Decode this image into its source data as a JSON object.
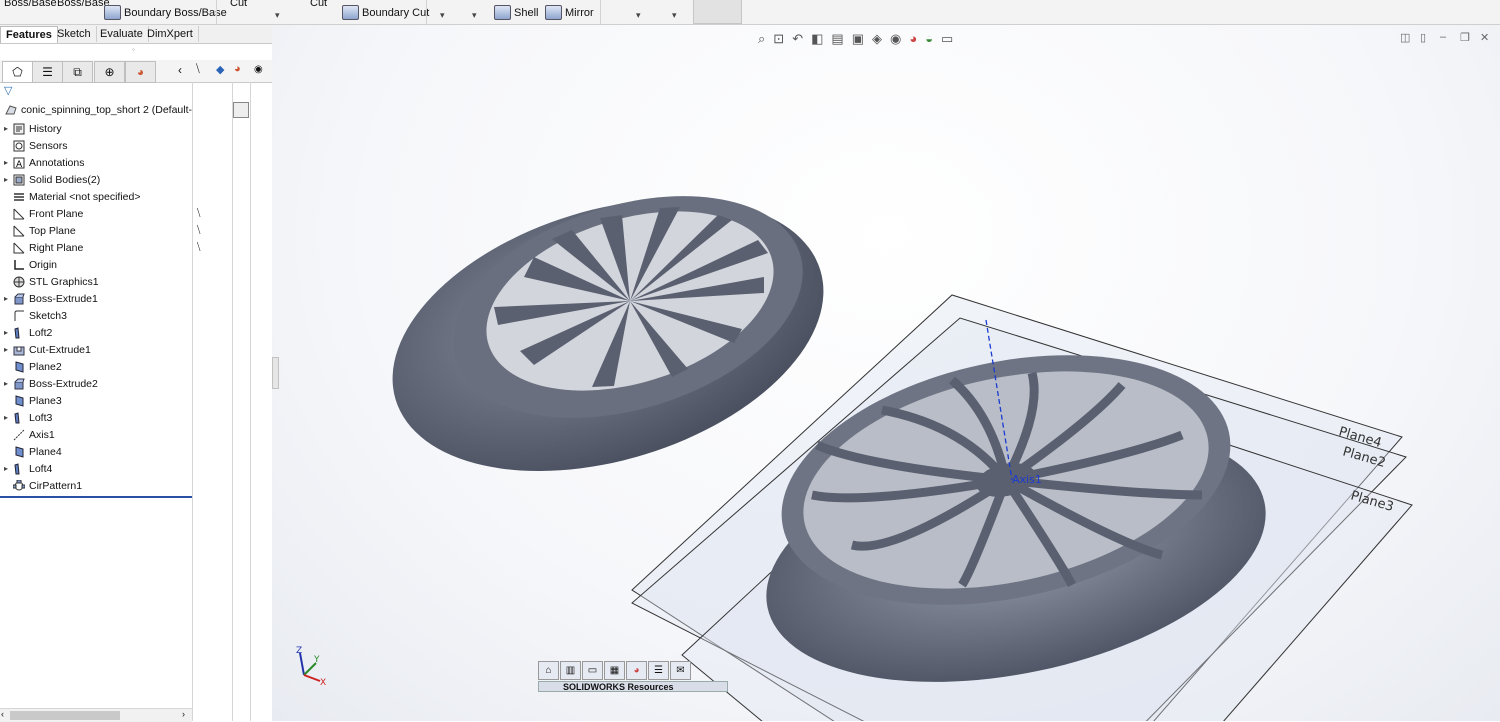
{
  "ribbon": {
    "boss_base_1": "Boss/Base",
    "boss_base_2": "Boss/Base",
    "boundary_boss": "Boundary Boss/Base",
    "cut_1": "Cut",
    "cut_2": "Cut",
    "boundary_cut": "Boundary Cut",
    "shell": "Shell",
    "mirror": "Mirror"
  },
  "command_tabs": [
    "Features",
    "Sketch",
    "Evaluate",
    "DimXpert"
  ],
  "tree": {
    "root": "conic_spinning_top_short 2  (Default-",
    "items": [
      {
        "label": "History",
        "icon": "history-icon",
        "expand": true
      },
      {
        "label": "Sensors",
        "icon": "sensor-icon",
        "expand": false
      },
      {
        "label": "Annotations",
        "icon": "annotation-icon",
        "expand": true
      },
      {
        "label": "Solid Bodies(2)",
        "icon": "solid-bodies-icon",
        "expand": true
      },
      {
        "label": "Material <not specified>",
        "icon": "material-icon",
        "expand": false
      },
      {
        "label": "Front Plane",
        "icon": "plane-icon",
        "expand": false
      },
      {
        "label": "Top Plane",
        "icon": "plane-icon",
        "expand": false
      },
      {
        "label": "Right Plane",
        "icon": "plane-icon",
        "expand": false
      },
      {
        "label": "Origin",
        "icon": "origin-icon",
        "expand": false
      },
      {
        "label": "STL Graphics1",
        "icon": "stl-icon",
        "expand": false
      },
      {
        "label": "Boss-Extrude1",
        "icon": "extrude-icon",
        "expand": true
      },
      {
        "label": "Sketch3",
        "icon": "sketch-icon",
        "expand": false
      },
      {
        "label": "Loft2",
        "icon": "loft-icon",
        "expand": true
      },
      {
        "label": "Cut-Extrude1",
        "icon": "cut-icon",
        "expand": true
      },
      {
        "label": "Plane2",
        "icon": "ref-plane-icon",
        "expand": false
      },
      {
        "label": "Boss-Extrude2",
        "icon": "extrude-icon",
        "expand": true
      },
      {
        "label": "Plane3",
        "icon": "ref-plane-icon",
        "expand": false
      },
      {
        "label": "Loft3",
        "icon": "loft-icon",
        "expand": true
      },
      {
        "label": "Axis1",
        "icon": "axis-icon",
        "expand": false
      },
      {
        "label": "Plane4",
        "icon": "ref-plane-icon",
        "expand": false
      },
      {
        "label": "Loft4",
        "icon": "loft-icon",
        "expand": true
      },
      {
        "label": "CirPattern1",
        "icon": "circular-pattern-icon",
        "expand": false
      }
    ]
  },
  "viewport": {
    "plane_labels": [
      "Plane4",
      "Plane2",
      "Plane3"
    ],
    "axis_label": "Axis1",
    "triad": {
      "x": "X",
      "y": "Y",
      "z": "Z"
    }
  },
  "task_pane": {
    "title": "SOLIDWORKS Resources"
  },
  "colors": {
    "part_body": "#5b6170",
    "selection_blue": "#2a4fa3",
    "axis_blue": "#1b3bd1"
  }
}
